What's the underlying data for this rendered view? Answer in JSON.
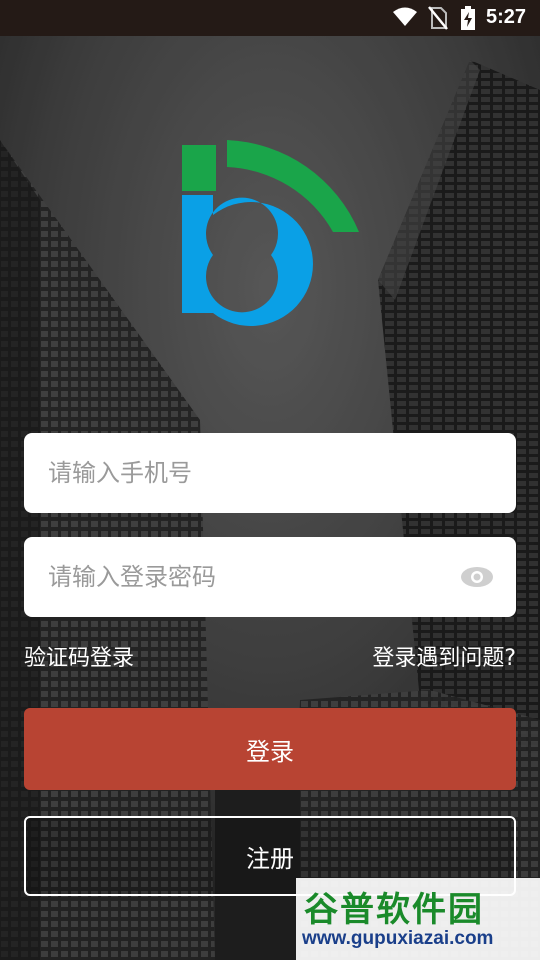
{
  "status_bar": {
    "time": "5:27",
    "icons": [
      "wifi-icon",
      "no-sim-icon",
      "battery-charging-icon"
    ]
  },
  "logo": {
    "blue": "#0aa0e6",
    "green": "#1aa54a"
  },
  "form": {
    "phone_placeholder": "请输入手机号",
    "password_placeholder": "请输入登录密码",
    "sms_login_label": "验证码登录",
    "login_problem_label": "登录遇到问题?",
    "login_button": "登录",
    "register_button": "注册"
  },
  "colors": {
    "login_button": "#b84433",
    "status_bar": "#241a16"
  },
  "watermark": {
    "title": "谷普软件园",
    "url": "www.gupuxiazai.com"
  }
}
